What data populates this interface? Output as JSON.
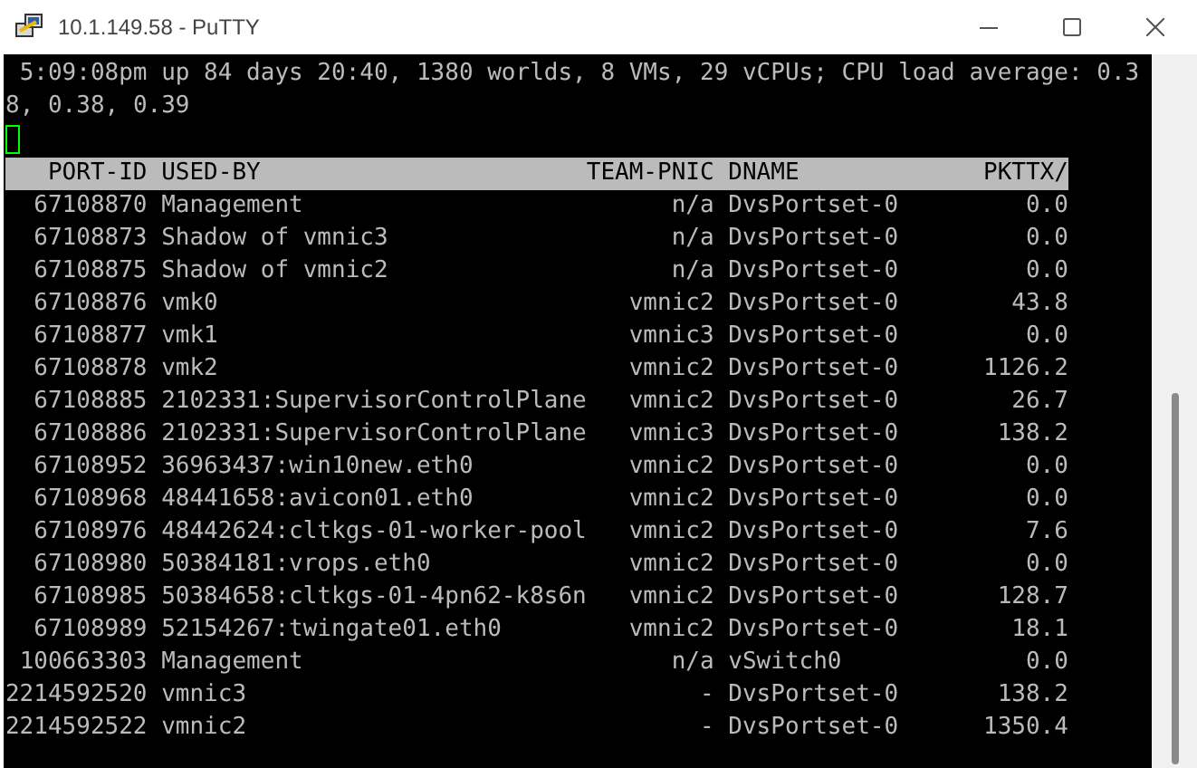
{
  "window": {
    "title": "10.1.149.58 - PuTTY"
  },
  "terminal": {
    "status_lines": [
      "5:09:08pm up 84 days 20:40, 1380 worlds, 8 VMs, 29 vCPUs; CPU load average: 0.3",
      "8, 0.38, 0.39"
    ],
    "columns": [
      "PORT-ID",
      "USED-BY",
      "TEAM-PNIC",
      "DNAME",
      "PKTTX/"
    ],
    "rows": [
      {
        "port_id": "67108870",
        "used_by": "Management",
        "team_pnic": "n/a",
        "dname": "DvsPortset-0",
        "pkttx": "0.0"
      },
      {
        "port_id": "67108873",
        "used_by": "Shadow of vmnic3",
        "team_pnic": "n/a",
        "dname": "DvsPortset-0",
        "pkttx": "0.0"
      },
      {
        "port_id": "67108875",
        "used_by": "Shadow of vmnic2",
        "team_pnic": "n/a",
        "dname": "DvsPortset-0",
        "pkttx": "0.0"
      },
      {
        "port_id": "67108876",
        "used_by": "vmk0",
        "team_pnic": "vmnic2",
        "dname": "DvsPortset-0",
        "pkttx": "43.8"
      },
      {
        "port_id": "67108877",
        "used_by": "vmk1",
        "team_pnic": "vmnic3",
        "dname": "DvsPortset-0",
        "pkttx": "0.0"
      },
      {
        "port_id": "67108878",
        "used_by": "vmk2",
        "team_pnic": "vmnic2",
        "dname": "DvsPortset-0",
        "pkttx": "1126.2"
      },
      {
        "port_id": "67108885",
        "used_by": "2102331:SupervisorControlPlane",
        "team_pnic": "vmnic2",
        "dname": "DvsPortset-0",
        "pkttx": "26.7"
      },
      {
        "port_id": "67108886",
        "used_by": "2102331:SupervisorControlPlane",
        "team_pnic": "vmnic3",
        "dname": "DvsPortset-0",
        "pkttx": "138.2"
      },
      {
        "port_id": "67108952",
        "used_by": "36963437:win10new.eth0",
        "team_pnic": "vmnic2",
        "dname": "DvsPortset-0",
        "pkttx": "0.0"
      },
      {
        "port_id": "67108968",
        "used_by": "48441658:avicon01.eth0",
        "team_pnic": "vmnic2",
        "dname": "DvsPortset-0",
        "pkttx": "0.0"
      },
      {
        "port_id": "67108976",
        "used_by": "48442624:cltkgs-01-worker-pool",
        "team_pnic": "vmnic2",
        "dname": "DvsPortset-0",
        "pkttx": "7.6"
      },
      {
        "port_id": "67108980",
        "used_by": "50384181:vrops.eth0",
        "team_pnic": "vmnic2",
        "dname": "DvsPortset-0",
        "pkttx": "0.0"
      },
      {
        "port_id": "67108985",
        "used_by": "50384658:cltkgs-01-4pn62-k8s6n",
        "team_pnic": "vmnic2",
        "dname": "DvsPortset-0",
        "pkttx": "128.7"
      },
      {
        "port_id": "67108989",
        "used_by": "52154267:twingate01.eth0",
        "team_pnic": "vmnic2",
        "dname": "DvsPortset-0",
        "pkttx": "18.1"
      },
      {
        "port_id": "100663303",
        "used_by": "Management",
        "team_pnic": "n/a",
        "dname": "vSwitch0",
        "pkttx": "0.0"
      },
      {
        "port_id": "2214592520",
        "used_by": "vmnic3",
        "team_pnic": "-",
        "dname": "DvsPortset-0",
        "pkttx": "138.2"
      },
      {
        "port_id": "2214592522",
        "used_by": "vmnic2",
        "team_pnic": "-",
        "dname": "DvsPortset-0",
        "pkttx": "1350.4"
      }
    ]
  }
}
